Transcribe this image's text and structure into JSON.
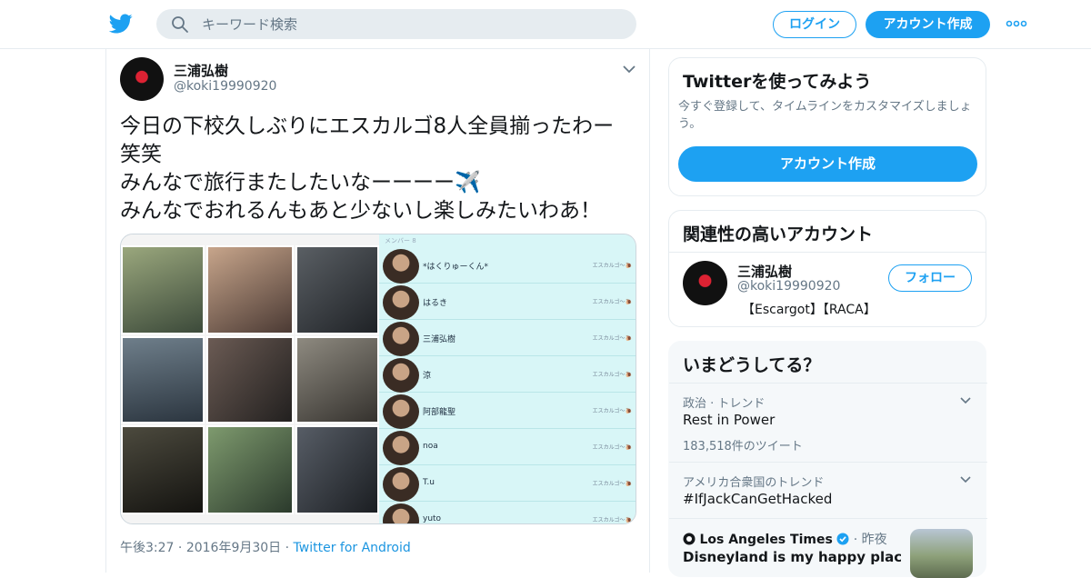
{
  "header": {
    "search_placeholder": "キーワード検索",
    "login_label": "ログイン",
    "signup_label": "アカウント作成",
    "brand_color": "#1da1f2"
  },
  "tweet": {
    "display_name": "三浦弘樹",
    "handle": "@koki19990920",
    "text_lines": [
      "今日の下校久しぶりにエスカルゴ8人全員揃ったわー",
      "笑笑",
      "みんなで旅行またしたいなーーーー✈️",
      "みんなでおれるんもあと少ないし楽しみたいわあ！"
    ],
    "time": "午後3:27",
    "date": "2016年9月30日",
    "source": "Twitter for Android",
    "media": {
      "members_header": "メンバー 8",
      "members": [
        {
          "name": "*はくりゅーくん*",
          "group": "エスカルゴ〜🐌"
        },
        {
          "name": "はるき",
          "group": "エスカルゴ〜🐌"
        },
        {
          "name": "三浦弘樹",
          "group": "エスカルゴ〜🐌"
        },
        {
          "name": "涼",
          "group": "エスカルゴ〜🐌"
        },
        {
          "name": "阿部龍聖",
          "group": "エスカルゴ〜🐌"
        },
        {
          "name": "noa",
          "group": "エスカルゴ〜🐌"
        },
        {
          "name": "T.u",
          "group": "エスカルゴ〜🐌"
        },
        {
          "name": "yuto",
          "group": "エスカルゴ〜🐌"
        }
      ]
    }
  },
  "signup_card": {
    "title": "Twitterを使ってみよう",
    "description": "今すぐ登録して、タイムラインをカスタマイズしましょう。",
    "button_label": "アカウント作成"
  },
  "related_card": {
    "title": "関連性の高いアカウント",
    "name": "三浦弘樹",
    "handle": "@koki19990920",
    "bio": "【Escargot】【RACA】",
    "follow_label": "フォロー"
  },
  "trends_card": {
    "title": "いまどうしてる？",
    "trends": [
      {
        "meta": "政治 · トレンド",
        "name": "Rest in Power",
        "count": "183,518件のツイート"
      },
      {
        "meta": "アメリカ合衆国のトレンド",
        "name": "#IfJackCanGetHacked",
        "count": ""
      }
    ],
    "news": {
      "source": "Los Angeles Times",
      "time": "昨夜",
      "headline": "Disneyland is my happy place. But I'm glad it's closed during COVID"
    }
  }
}
